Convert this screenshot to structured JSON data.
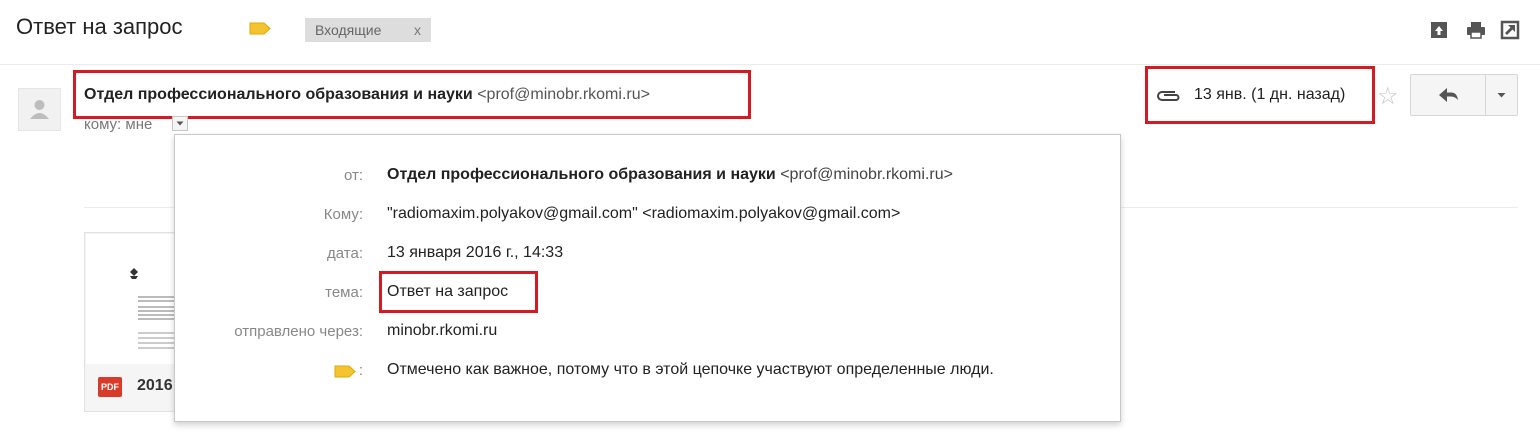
{
  "header": {
    "subject": "Ответ на запрос",
    "label_chip": "Входящие",
    "label_remove": "x",
    "icons": [
      "archive-icon",
      "print-icon",
      "new-window-icon"
    ]
  },
  "message": {
    "sender_name": "Отдел профессионального образования и науки",
    "sender_email": "<prof@minobr.rkomi.ru>",
    "to_me": "кому: мне",
    "date": "13 янв. (1 дн. назад)"
  },
  "details": {
    "from_label": "от:",
    "from_name": "Отдел профессионального образования и науки",
    "from_email": "<prof@minobr.rkomi.ru>",
    "to_label": "Кому:",
    "to_value": "\"radiomaxim.polyakov@gmail.com\" <radiomaxim.polyakov@gmail.com>",
    "date_label": "дата:",
    "date_value": "13 января 2016 г., 14:33",
    "subject_label": "тема:",
    "subject_value": "Ответ на запрос",
    "mailedby_label": "отправлено через:",
    "mailedby_value": "minobr.rkomi.ru",
    "importance_label": ":",
    "importance_value": "Отмечено как важное, потому что в этой цепочке участвуют определенные люди."
  },
  "attachment": {
    "type_badge": "PDF",
    "name": "2016"
  },
  "colors": {
    "highlight_box": "#d61a21",
    "important_marker": "#f4c430",
    "label_chip_bg": "#dddddd"
  }
}
